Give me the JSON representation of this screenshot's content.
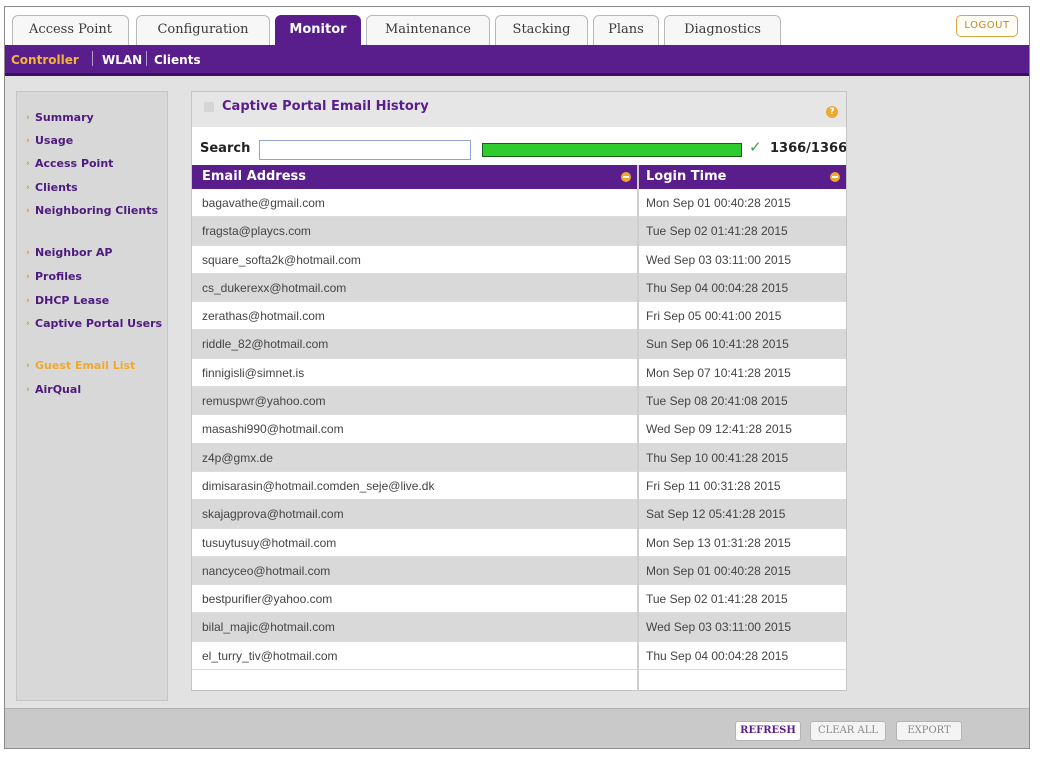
{
  "tabs": [
    {
      "label": "Access Point",
      "active": false
    },
    {
      "label": "Configuration",
      "active": false
    },
    {
      "label": "Monitor",
      "active": true
    },
    {
      "label": "Maintenance",
      "active": false
    },
    {
      "label": "Stacking",
      "active": false
    },
    {
      "label": "Plans",
      "active": false
    },
    {
      "label": "Diagnostics",
      "active": false
    }
  ],
  "logout_label": "LOGOUT",
  "subnav": {
    "items": [
      "Controller",
      "WLAN",
      "Clients"
    ],
    "active": "Controller"
  },
  "sidebar": {
    "items": [
      "Summary",
      "Usage",
      "Access Point",
      "Clients",
      "Neighboring Clients",
      "Neighbor AP",
      "Profiles",
      "DHCP Lease",
      "Captive Portal Users",
      "Guest Email List",
      "AirQual"
    ],
    "active": "Guest Email List"
  },
  "panel": {
    "title": "Captive Portal Email History",
    "help_icon": "help-icon",
    "search_label": "Search",
    "search_value": "",
    "progress_fraction": 1.0,
    "count": "1366/1366"
  },
  "table": {
    "columns": [
      "Email Address",
      "Login Time"
    ],
    "rows": [
      [
        "bagavathe@gmail.com",
        "Mon Sep 01 00:40:28 2015"
      ],
      [
        "fragsta@playcs.com",
        "Tue Sep 02 01:41:28 2015"
      ],
      [
        "square_softa2k@hotmail.com",
        "Wed Sep 03 03:11:00 2015"
      ],
      [
        "cs_dukerexx@hotmail.com",
        "Thu Sep 04 00:04:28 2015"
      ],
      [
        "zerathas@hotmail.com",
        "Fri Sep 05 00:41:00 2015"
      ],
      [
        "riddle_82@hotmail.com",
        "Sun Sep 06 10:41:28 2015"
      ],
      [
        "finnigisli@simnet.is",
        "Mon Sep 07 10:41:28 2015"
      ],
      [
        "remuspwr@yahoo.com",
        "Tue Sep 08 20:41:08 2015"
      ],
      [
        "masashi990@hotmail.com",
        "Wed Sep 09 12:41:28 2015"
      ],
      [
        "z4p@gmx.de",
        "Thu Sep 10 00:41:28 2015"
      ],
      [
        "dimisarasin@hotmail.comden_seje@live.dk",
        "Fri Sep 11 00:31:28 2015"
      ],
      [
        "skajagprova@hotmail.com",
        "Sat Sep 12 05:41:28 2015"
      ],
      [
        "tusuytusuy@hotmail.com",
        "Mon Sep 13 01:31:28 2015"
      ],
      [
        "nancyceo@hotmail.com",
        "Mon Sep 01 00:40:28 2015"
      ],
      [
        "bestpurifier@yahoo.com",
        "Tue Sep 02 01:41:28 2015"
      ],
      [
        "bilal_majic@hotmail.com",
        "Wed Sep 03 03:11:00 2015"
      ],
      [
        "el_turry_tiv@hotmail.com",
        "Thu Sep 04 00:04:28 2015"
      ]
    ]
  },
  "buttons": {
    "refresh": "REFRESH",
    "clear_all": "CLEAR ALL",
    "export": "EXPORT"
  },
  "colors": {
    "brand_purple": "#5a1d8c",
    "accent_orange": "#f0a830",
    "progress_green": "#2ecc2e"
  }
}
